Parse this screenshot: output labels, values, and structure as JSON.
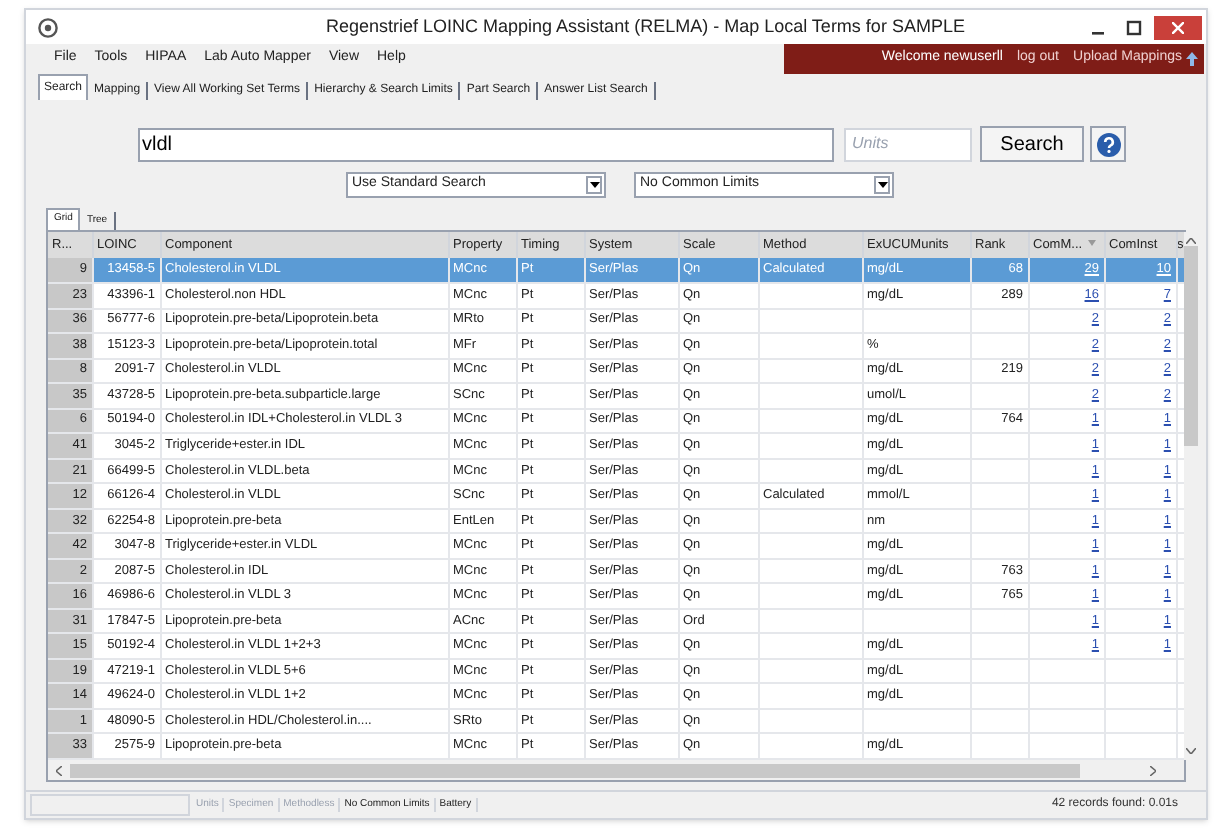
{
  "window": {
    "title": "Regenstrief LOINC Mapping Assistant (RELMA) - Map Local Terms  for SAMPLE"
  },
  "menu": [
    "File",
    "Tools",
    "HIPAA",
    "Lab Auto Mapper",
    "View",
    "Help"
  ],
  "user_bar": {
    "welcome": "Welcome newuserll",
    "logout": "log out",
    "upload": "Upload Mappings"
  },
  "tabs": [
    {
      "label": "Search",
      "selected": true
    },
    {
      "label": "Mapping",
      "selected": false
    },
    {
      "label": "View All Working Set Terms",
      "selected": false
    },
    {
      "label": "Hierarchy & Search Limits",
      "selected": false
    },
    {
      "label": "Part Search",
      "selected": false
    },
    {
      "label": "Answer List Search",
      "selected": false
    }
  ],
  "search": {
    "value": "vldl",
    "units_placeholder": "Units",
    "button": "Search"
  },
  "dropdowns": [
    "Use Standard Search",
    "No Common Limits"
  ],
  "view_tabs": [
    {
      "label": "Grid",
      "selected": true
    },
    {
      "label": "Tree",
      "selected": false
    }
  ],
  "table": {
    "columns": [
      {
        "label": "R...",
        "sorted": false
      },
      {
        "label": "LOINC",
        "sorted": false
      },
      {
        "label": "Component",
        "sorted": false
      },
      {
        "label": "Property",
        "sorted": false
      },
      {
        "label": "Timing",
        "sorted": false
      },
      {
        "label": "System",
        "sorted": false
      },
      {
        "label": "Scale",
        "sorted": false
      },
      {
        "label": "Method",
        "sorted": false
      },
      {
        "label": "ExUCUMunits",
        "sorted": false
      },
      {
        "label": "Rank",
        "sorted": false
      },
      {
        "label": "ComM...",
        "sorted": true
      },
      {
        "label": "ComInst",
        "sorted": false
      }
    ],
    "cut_column": "s",
    "rows": [
      {
        "r": "9",
        "loinc": "13458-5",
        "component": "Cholesterol.in VLDL",
        "property": "MCnc",
        "timing": "Pt",
        "system": "Ser/Plas",
        "scale": "Qn",
        "method": "Calculated",
        "units": "mg/dL",
        "rank": "68",
        "comm": "29",
        "cominst": "10",
        "selected": true
      },
      {
        "r": "23",
        "loinc": "43396-1",
        "component": "Cholesterol.non HDL",
        "property": "MCnc",
        "timing": "Pt",
        "system": "Ser/Plas",
        "scale": "Qn",
        "units": "mg/dL",
        "rank": "289",
        "comm": "16",
        "cominst": "7",
        "selected": false
      },
      {
        "r": "36",
        "loinc": "56777-6",
        "component": "Lipoprotein.pre-beta/Lipoprotein.beta",
        "property": "MRto",
        "timing": "Pt",
        "system": "Ser/Plas",
        "scale": "Qn",
        "comm": "2",
        "cominst": "2",
        "selected": false
      },
      {
        "r": "38",
        "loinc": "15123-3",
        "component": "Lipoprotein.pre-beta/Lipoprotein.total",
        "property": "MFr",
        "timing": "Pt",
        "system": "Ser/Plas",
        "scale": "Qn",
        "units": "%",
        "comm": "2",
        "cominst": "2",
        "selected": false
      },
      {
        "r": "8",
        "loinc": "2091-7",
        "component": "Cholesterol.in VLDL",
        "property": "MCnc",
        "timing": "Pt",
        "system": "Ser/Plas",
        "scale": "Qn",
        "units": "mg/dL",
        "rank": "219",
        "comm": "2",
        "cominst": "2",
        "selected": false
      },
      {
        "r": "35",
        "loinc": "43728-5",
        "component": "Lipoprotein.pre-beta.subparticle.large",
        "property": "SCnc",
        "timing": "Pt",
        "system": "Ser/Plas",
        "scale": "Qn",
        "units": "umol/L",
        "comm": "2",
        "cominst": "2",
        "selected": false
      },
      {
        "r": "6",
        "loinc": "50194-0",
        "component": "Cholesterol.in IDL+Cholesterol.in VLDL 3",
        "property": "MCnc",
        "timing": "Pt",
        "system": "Ser/Plas",
        "scale": "Qn",
        "units": "mg/dL",
        "rank": "764",
        "comm": "1",
        "cominst": "1",
        "selected": false
      },
      {
        "r": "41",
        "loinc": "3045-2",
        "component": "Triglyceride+ester.in IDL",
        "property": "MCnc",
        "timing": "Pt",
        "system": "Ser/Plas",
        "scale": "Qn",
        "units": "mg/dL",
        "comm": "1",
        "cominst": "1",
        "selected": false
      },
      {
        "r": "21",
        "loinc": "66499-5",
        "component": "Cholesterol.in VLDL.beta",
        "property": "MCnc",
        "timing": "Pt",
        "system": "Ser/Plas",
        "scale": "Qn",
        "units": "mg/dL",
        "comm": "1",
        "cominst": "1",
        "selected": false
      },
      {
        "r": "12",
        "loinc": "66126-4",
        "component": "Cholesterol.in VLDL",
        "property": "SCnc",
        "timing": "Pt",
        "system": "Ser/Plas",
        "scale": "Qn",
        "method": "Calculated",
        "units": "mmol/L",
        "comm": "1",
        "cominst": "1",
        "selected": false
      },
      {
        "r": "32",
        "loinc": "62254-8",
        "component": "Lipoprotein.pre-beta",
        "property": "EntLen",
        "timing": "Pt",
        "system": "Ser/Plas",
        "scale": "Qn",
        "units": "nm",
        "comm": "1",
        "cominst": "1",
        "selected": false
      },
      {
        "r": "42",
        "loinc": "3047-8",
        "component": "Triglyceride+ester.in VLDL",
        "property": "MCnc",
        "timing": "Pt",
        "system": "Ser/Plas",
        "scale": "Qn",
        "units": "mg/dL",
        "comm": "1",
        "cominst": "1",
        "selected": false
      },
      {
        "r": "2",
        "loinc": "2087-5",
        "component": "Cholesterol.in IDL",
        "property": "MCnc",
        "timing": "Pt",
        "system": "Ser/Plas",
        "scale": "Qn",
        "units": "mg/dL",
        "rank": "763",
        "comm": "1",
        "cominst": "1",
        "selected": false
      },
      {
        "r": "16",
        "loinc": "46986-6",
        "component": "Cholesterol.in VLDL 3",
        "property": "MCnc",
        "timing": "Pt",
        "system": "Ser/Plas",
        "scale": "Qn",
        "units": "mg/dL",
        "rank": "765",
        "comm": "1",
        "cominst": "1",
        "selected": false
      },
      {
        "r": "31",
        "loinc": "17847-5",
        "component": "Lipoprotein.pre-beta",
        "property": "ACnc",
        "timing": "Pt",
        "system": "Ser/Plas",
        "scale": "Ord",
        "comm": "1",
        "cominst": "1",
        "selected": false
      },
      {
        "r": "15",
        "loinc": "50192-4",
        "component": "Cholesterol.in VLDL 1+2+3",
        "property": "MCnc",
        "timing": "Pt",
        "system": "Ser/Plas",
        "scale": "Qn",
        "units": "mg/dL",
        "comm": "1",
        "cominst": "1",
        "selected": false
      },
      {
        "r": "19",
        "loinc": "47219-1",
        "component": "Cholesterol.in VLDL 5+6",
        "property": "MCnc",
        "timing": "Pt",
        "system": "Ser/Plas",
        "scale": "Qn",
        "units": "mg/dL",
        "selected": false
      },
      {
        "r": "14",
        "loinc": "49624-0",
        "component": "Cholesterol.in VLDL 1+2",
        "property": "MCnc",
        "timing": "Pt",
        "system": "Ser/Plas",
        "scale": "Qn",
        "units": "mg/dL",
        "selected": false
      },
      {
        "r": "1",
        "loinc": "48090-5",
        "component": "Cholesterol.in  HDL/Cholesterol.in....",
        "property": "SRto",
        "timing": "Pt",
        "system": "Ser/Plas",
        "scale": "Qn",
        "selected": false
      },
      {
        "r": "33",
        "loinc": "2575-9",
        "component": "Lipoprotein.pre-beta",
        "property": "MCnc",
        "timing": "Pt",
        "system": "Ser/Plas",
        "scale": "Qn",
        "units": "mg/dL",
        "selected": false
      }
    ]
  },
  "status_bar": {
    "filters": [
      {
        "label": "Units",
        "disabled": true
      },
      {
        "label": "Specimen",
        "disabled": true
      },
      {
        "label": "Methodless",
        "disabled": true
      },
      {
        "label": "No Common Limits",
        "disabled": false
      },
      {
        "label": "Battery",
        "disabled": false
      }
    ],
    "records": "42 records found: 0.01s"
  }
}
